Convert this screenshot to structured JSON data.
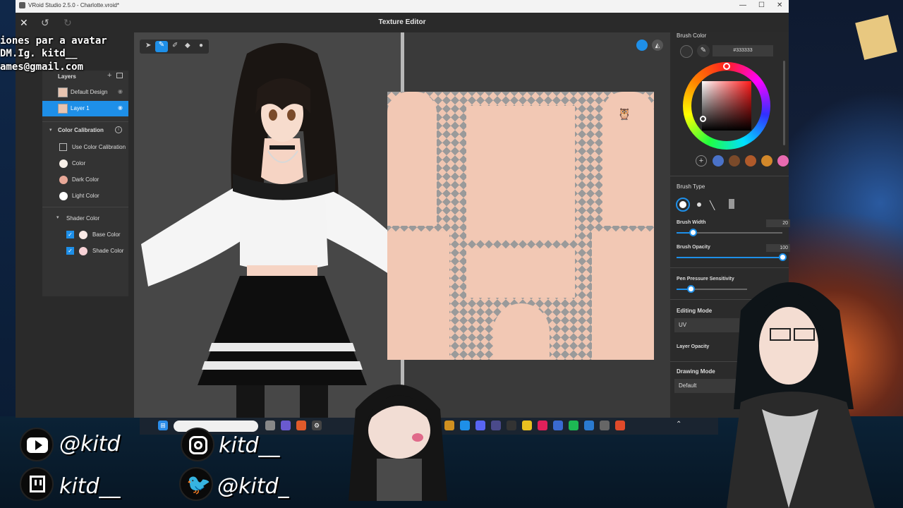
{
  "window": {
    "title": "VRoid Studio 2.5.0 - Charlotte.vroid*",
    "center_title": "Texture Editor",
    "minimize": "—",
    "maximize": "☐",
    "close": "✕"
  },
  "toolbar": {
    "close_icon": "✕",
    "undo_icon": "↺",
    "redo_icon": "↻"
  },
  "overlay": {
    "line1": "iones par a avatar",
    "line2": "DM.Ig. kitd__",
    "line3": "ames@gmail.com"
  },
  "layers": {
    "header": "Layers",
    "items": [
      {
        "label": "Default Design"
      },
      {
        "label": "Layer 1"
      }
    ]
  },
  "color_calibration": {
    "header": "Color Calibration",
    "use_label": "Use Color Calibration",
    "color_label": "Color",
    "dark_label": "Dark Color",
    "light_label": "Light Color",
    "shader_header": "Shader Color",
    "base_label": "Base Color",
    "shade_label": "Shade Color",
    "colors": {
      "color": "#f7efe8",
      "dark": "#e8a898",
      "light": "#ffffff",
      "base": "#fbeae6",
      "shade": "#f7d2d6"
    }
  },
  "brush_color": {
    "header": "Brush Color",
    "hex": "#333333",
    "presets": [
      "#4a72c8",
      "#7a4a2a",
      "#b05a2a",
      "#d2882a",
      "#e86ab0"
    ]
  },
  "brush_type": {
    "header": "Brush Type",
    "width_label": "Brush Width",
    "width_value": "20",
    "width_fraction": 0.15,
    "opacity_label": "Brush Opacity",
    "opacity_value": "100",
    "opacity_fraction": 1.0,
    "pressure_label": "Pen Pressure Sensitivity",
    "pressure_fraction": 0.2
  },
  "editing_mode": {
    "header": "Editing Mode",
    "value": "UV",
    "layer_opacity_label": "Layer Opacity",
    "drawing_mode_header": "Drawing Mode",
    "drawing_mode_value": "Default"
  },
  "social": {
    "youtube": "@kitd",
    "instagram": "kitd__",
    "twitch": "kitd__",
    "twitter": "@kitd_"
  }
}
